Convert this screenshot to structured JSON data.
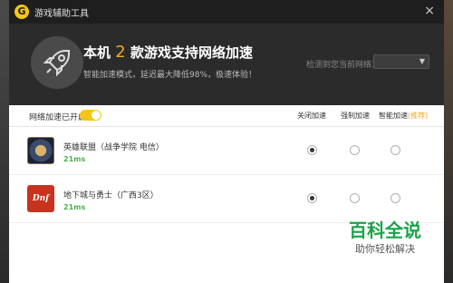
{
  "window": {
    "title": "游戏辅助工具",
    "app_icon": "G",
    "close_label": "×"
  },
  "header": {
    "headline_prefix": "本机",
    "game_count": "2",
    "headline_suffix": "款游戏支持网络加速",
    "subline": "智能加速模式，延迟最大降低98%，极速体验！",
    "detect_label": "检测到您当前网络为",
    "network_select_value": "",
    "rocket_icon": "rocket-icon"
  },
  "toolbar": {
    "accel_label": "网络加速已开启",
    "accel_enabled": true,
    "columns": {
      "off": "关闭加速",
      "force": "强制加速",
      "smart": "智能加速",
      "recommended": "(推荐)"
    }
  },
  "games": [
    {
      "name": "英雄联盟（战争学院 电信）",
      "ping": "21ms",
      "mode": "off"
    },
    {
      "name": "地下城与勇士（广西3区）",
      "ping": "21ms",
      "mode": "off",
      "icon_text": "Dnf"
    }
  ],
  "watermark": {
    "title": "百科全说",
    "subtitle": "助你轻松解决"
  },
  "colors": {
    "accent": "#f5c518",
    "recommend": "#f5a623",
    "ping": "#4caf50",
    "header_bg": "#2b2b2b"
  }
}
